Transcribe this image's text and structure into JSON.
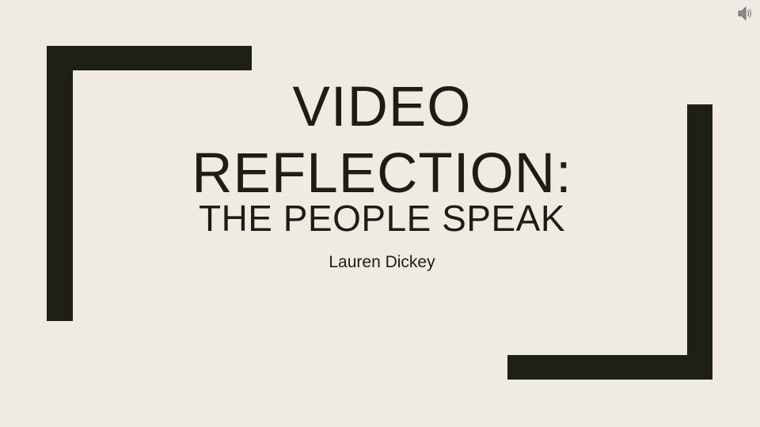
{
  "slide": {
    "title_line1": "VIDEO",
    "title_line2": "REFLECTION:",
    "subtitle": "THE PEOPLE SPEAK",
    "author": "Lauren Dickey"
  },
  "icons": {
    "audio": "speaker-icon"
  },
  "colors": {
    "background": "#efebe4",
    "bracket": "#1e1f16",
    "text": "#1d1d15"
  }
}
